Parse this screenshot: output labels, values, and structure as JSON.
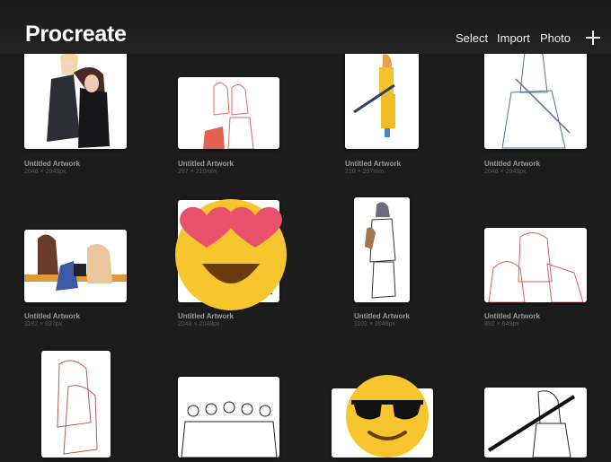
{
  "header": {
    "title": "Procreate",
    "select_label": "Select",
    "import_label": "Import",
    "photo_label": "Photo",
    "add_icon": "plus-icon"
  },
  "gallery": [
    {
      "name": "Untitled Artwork",
      "size": "2048 × 2048px",
      "subject": "couple in black suit and dress, full color"
    },
    {
      "name": "Untitled Artwork",
      "size": "297 × 210mm",
      "subject": "two girls, red line sketch"
    },
    {
      "name": "Untitled Artwork",
      "size": "210 × 297mm",
      "subject": "girl in yellow outfit with rifle"
    },
    {
      "name": "Untitled Artwork",
      "size": "2048 × 2048px",
      "subject": "long-haired figure in suit, blue line sketch"
    },
    {
      "name": "Untitled Artwork",
      "size": "1182 × 837px",
      "subject": "two girls sitting on bench, color"
    },
    {
      "name": "Untitled Artwork",
      "size": "2048 × 2048px",
      "subject": "line sketch partially covered by sticker"
    },
    {
      "name": "Untitled Artwork",
      "size": "1102 × 2048px",
      "subject": "figure in hat and coat, line sketch"
    },
    {
      "name": "Untitled Artwork",
      "size": "892 × 649px",
      "subject": "girls, red line sketch"
    },
    {
      "name": "",
      "size": "",
      "subject": "two figures hugging, red line sketch"
    },
    {
      "name": "",
      "size": "",
      "subject": "group of five men, black line sketch"
    },
    {
      "name": "",
      "size": "",
      "subject": "sketch partially covered by sticker"
    },
    {
      "name": "",
      "size": "",
      "subject": "girl holding bat, black line sketch"
    }
  ],
  "stickers": [
    {
      "icon": "heart-eyes-emoji-icon"
    },
    {
      "icon": "sunglasses-emoji-icon"
    }
  ],
  "colors": {
    "background": "#1c1c1c",
    "emoji": "#f7c52d",
    "heart": "#e9516a"
  }
}
